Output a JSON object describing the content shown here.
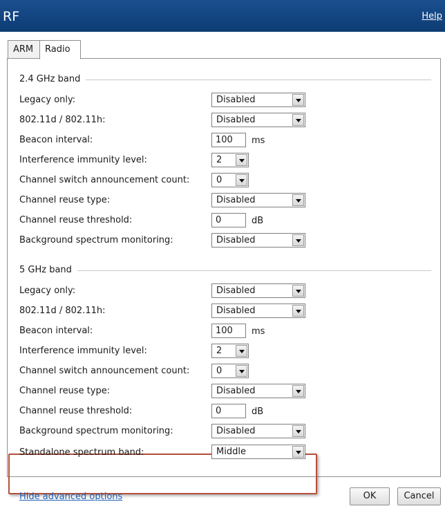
{
  "window": {
    "title": "RF",
    "help_label": "Help"
  },
  "tabs": [
    {
      "label": "ARM"
    },
    {
      "label": "Radio"
    }
  ],
  "band24": {
    "legend": "2.4 GHz band",
    "legacy_label": "Legacy only:",
    "legacy_value": "Disabled",
    "dot11dh_label": "802.11d / 802.11h:",
    "dot11dh_value": "Disabled",
    "beacon_label": "Beacon interval:",
    "beacon_value": "100",
    "beacon_unit": "ms",
    "interference_label": "Interference immunity level:",
    "interference_value": "2",
    "csa_label": "Channel switch announcement count:",
    "csa_value": "0",
    "reuse_type_label": "Channel reuse type:",
    "reuse_type_value": "Disabled",
    "reuse_threshold_label": "Channel reuse threshold:",
    "reuse_threshold_value": "0",
    "reuse_threshold_unit": "dB",
    "spectrum_label": "Background spectrum monitoring:",
    "spectrum_value": "Disabled"
  },
  "band5": {
    "legend": "5 GHz band",
    "legacy_label": "Legacy only:",
    "legacy_value": "Disabled",
    "dot11dh_label": "802.11d / 802.11h:",
    "dot11dh_value": "Disabled",
    "beacon_label": "Beacon interval:",
    "beacon_value": "100",
    "beacon_unit": "ms",
    "interference_label": "Interference immunity level:",
    "interference_value": "2",
    "csa_label": "Channel switch announcement count:",
    "csa_value": "0",
    "reuse_type_label": "Channel reuse type:",
    "reuse_type_value": "Disabled",
    "reuse_threshold_label": "Channel reuse threshold:",
    "reuse_threshold_value": "0",
    "reuse_threshold_unit": "dB",
    "spectrum_label": "Background spectrum monitoring:",
    "spectrum_value": "Disabled",
    "standalone_label": "Standalone spectrum band:",
    "standalone_value": "Middle"
  },
  "footer": {
    "hide_advanced": "Hide advanced options",
    "ok": "OK",
    "cancel": "Cancel"
  },
  "colors": {
    "titlebar": "#0d3c73",
    "highlight": "#b5503c",
    "link": "#1f5fb0"
  }
}
